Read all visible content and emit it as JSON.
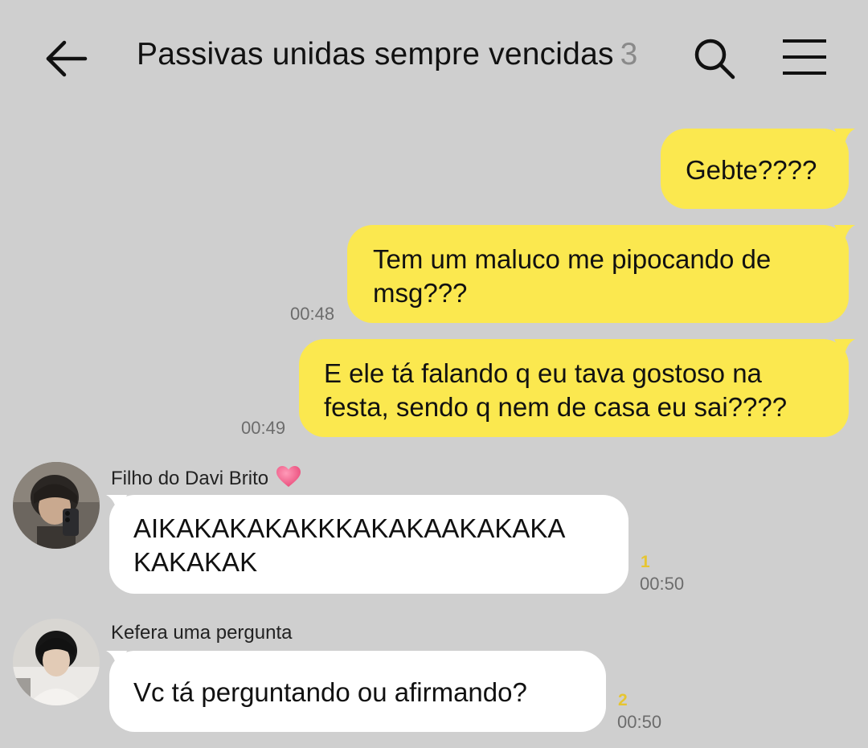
{
  "header": {
    "title": "Passivas unidas sempre vencidas",
    "member_count": "3",
    "back_icon": "arrow-left-icon",
    "search_icon": "search-icon",
    "menu_icon": "hamburger-menu-icon"
  },
  "colors": {
    "background": "#cfcfcf",
    "outgoing_bubble": "#fbe84f",
    "incoming_bubble": "#ffffff",
    "unread_count": "#e6c531"
  },
  "messages": [
    {
      "direction": "outgoing",
      "lines": [
        "Gebte????"
      ],
      "time": ""
    },
    {
      "direction": "outgoing",
      "lines": [
        "Tem um maluco me pipocando de",
        "msg???"
      ],
      "time": "00:48"
    },
    {
      "direction": "outgoing",
      "lines": [
        "E ele tá falando q eu tava gostoso na",
        "festa, sendo q nem de casa eu sai????"
      ],
      "time": "00:49"
    },
    {
      "direction": "incoming",
      "sender": "Filho do Davi Brito",
      "sender_emoji": "❤",
      "lines": [
        "AIKAKAKAKAKKKAKAKAAKAKAKA",
        "KAKAKAK"
      ],
      "unread": "1",
      "time": "00:50"
    },
    {
      "direction": "incoming",
      "sender": "Kefera uma pergunta",
      "lines": [
        "Vc tá perguntando ou afirmando?"
      ],
      "unread": "2",
      "time": "00:50"
    }
  ]
}
